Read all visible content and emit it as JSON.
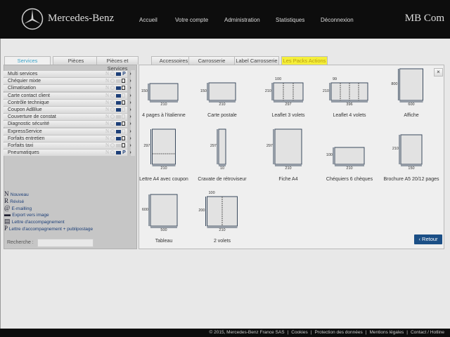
{
  "header": {
    "brand": "Mercedes-Benz",
    "nav": [
      "Accueil",
      "Votre compte",
      "Administration",
      "Statistiques",
      "Déconnexion"
    ],
    "app_name": "MB Com"
  },
  "tabs": [
    {
      "label": "Services",
      "state": "selected"
    },
    {
      "label": "Pièces"
    },
    {
      "label": "Pièces et Services"
    },
    {
      "label": "Accessoires"
    },
    {
      "label": "Carrosserie"
    },
    {
      "label": "Label Carrosserie"
    },
    {
      "label": "Les Packs Actions",
      "state": "highlighted"
    }
  ],
  "services": [
    {
      "label": "Multi services",
      "image": true,
      "doc": "P"
    },
    {
      "label": "Chéquier mixte",
      "image": false,
      "doc": "on"
    },
    {
      "label": "Climatisation",
      "image": true,
      "doc": "on"
    },
    {
      "label": "Carte contact client",
      "image": true,
      "doc": "off"
    },
    {
      "label": "Contrôle technique",
      "image": true,
      "doc": "on"
    },
    {
      "label": "Coupon AdBlue",
      "image": true,
      "doc": "off"
    },
    {
      "label": "Couverture de constat",
      "image": false,
      "doc": "off"
    },
    {
      "label": "Diagnostic sécurité",
      "image": true,
      "doc": "on"
    },
    {
      "label": "ExpressService",
      "image": true,
      "doc": "off"
    },
    {
      "label": "Forfaits entretien",
      "image": true,
      "doc": "on"
    },
    {
      "label": "Forfaits taxi",
      "image": false,
      "doc": "on"
    },
    {
      "label": "Pneumatiques",
      "image": true,
      "doc": "P"
    }
  ],
  "legend": [
    {
      "sym": "N",
      "label": "Nouveau"
    },
    {
      "sym": "R",
      "label": "Révisé"
    },
    {
      "sym": "@",
      "label": "E-mailling"
    },
    {
      "sym": "▬",
      "label": "Export vers image"
    },
    {
      "sym": "▤",
      "label": "Lettre d'accompagnement"
    },
    {
      "sym": "P",
      "label": "Lettre d'accompagnement + publipostage"
    }
  ],
  "search": {
    "label": "Recherche :",
    "value": ""
  },
  "formats": [
    {
      "label": "4 pages à l'italienne",
      "w": "210",
      "h": "150"
    },
    {
      "label": "Carte postale",
      "w": "210",
      "h": "150"
    },
    {
      "label": "Leaflet 3 volets",
      "w": "297",
      "h": "210",
      "top": "100"
    },
    {
      "label": "Leaflet 4 volets",
      "w": "396",
      "h": "210",
      "top": "99"
    },
    {
      "label": "Affiche",
      "w": "600",
      "h": "800"
    },
    {
      "label": "Lettre A4 avec coupon",
      "w": "210",
      "h": "297"
    },
    {
      "label": "Cravate de rétroviseur",
      "w": "10",
      "h": "297"
    },
    {
      "label": "Fiche A4",
      "w": "210",
      "h": "297"
    },
    {
      "label": "Chéquiers 6 chèques",
      "w": "210",
      "h": "100"
    },
    {
      "label": "Brochure A5 20/12 pages",
      "w": "150",
      "h": "210"
    },
    {
      "label": "Tableau",
      "w": "500",
      "h": "600"
    },
    {
      "label": "2 volets",
      "w": "210",
      "h": "200",
      "top": "100"
    }
  ],
  "buttons": {
    "close": "×",
    "back": "‹ Retour"
  },
  "footer": [
    "© 2015, Mercedes-Benz France SAS",
    "Cookies",
    "Protection des données",
    "Mentions légales",
    "Contact / Hotline"
  ],
  "colors": {
    "header": "#0d0d0d",
    "button": "#1b4f86",
    "highlight_tab": "#f5ef3a",
    "icon_active": "#1d3f78"
  }
}
